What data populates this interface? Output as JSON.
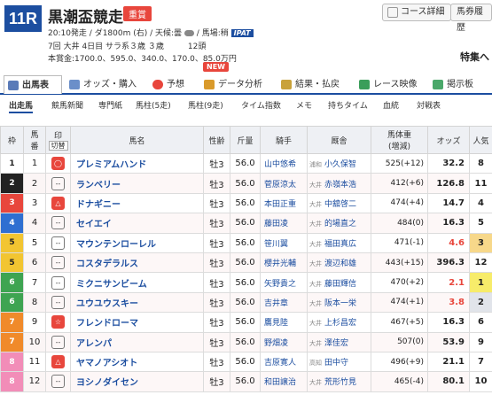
{
  "header": {
    "race_no": "11R",
    "race_name": "黒潮盃競走",
    "grade": "重賞",
    "course_btn": "コース詳細",
    "ticket_btn": "馬券履歴",
    "info1": "20:10発走 / ダ1800m (右) / 天候:曇",
    "info1b": "/ 馬場:稍",
    "ipat": "IPAT",
    "info2": "7回 大井 4日目 サラ系３歳 ３歳　　　12頭",
    "info3": "本賞金:1700.0、595.0、340.0、170.0、85.0万円",
    "tokushu": "特集へ",
    "new_badge": "NEW"
  },
  "tabs": [
    {
      "label": "出馬表",
      "icon": "horse-table-icon",
      "color": "#5a7bb8"
    },
    {
      "label": "オッズ・購入",
      "icon": "odds-chart-icon",
      "color": "#6b8fc9"
    },
    {
      "label": "予想",
      "icon": "target-icon",
      "color": "#e8463c"
    },
    {
      "label": "データ分析",
      "icon": "bar-chart-icon",
      "color": "#d99a2b"
    },
    {
      "label": "結果・払戻",
      "icon": "trophy-icon",
      "color": "#c9a23b"
    },
    {
      "label": "レース映像",
      "icon": "video-icon",
      "color": "#3b9e5a"
    },
    {
      "label": "掲示板",
      "icon": "chat-icon",
      "color": "#4aa86a"
    }
  ],
  "subtabs": [
    "出走馬",
    "競馬新聞",
    "専門紙",
    "馬柱(5走)",
    "馬柱(9走)",
    "タイム指数",
    "メモ",
    "持ちタイム",
    "血統",
    "対戦表"
  ],
  "table": {
    "headers": {
      "waku": "枠",
      "umaban1": "馬",
      "umaban2": "番",
      "mark1": "印",
      "mark2": "切替",
      "name": "馬名",
      "sex": "性齢",
      "kinryo": "斤量",
      "jockey": "騎手",
      "trainer": "厩舎",
      "weight1": "馬体重",
      "weight2": "(増減)",
      "odds": "オッズ",
      "pop": "人気"
    },
    "rows": [
      {
        "waku": "1",
        "waku_bg": "#ffffff",
        "waku_fg": "#222",
        "no": "1",
        "mark": "◯",
        "mark_type": "red",
        "name": "プレミアムハンド",
        "sex": "牡3",
        "kin": "56.0",
        "jockey": "山中悠希",
        "stable": "浦和",
        "trainer": "小久保智",
        "weight": "525(+12)",
        "odds": "32.2",
        "odds_color": "#222",
        "pop": "8",
        "pop_bg": "#ffffff"
      },
      {
        "waku": "2",
        "waku_bg": "#222222",
        "waku_fg": "#fff",
        "no": "2",
        "mark": "--",
        "mark_type": "gray",
        "name": "ランベリー",
        "sex": "牡3",
        "kin": "56.0",
        "jockey": "菅原涼太",
        "stable": "大井",
        "trainer": "赤嶺本浩",
        "weight": "412(+6)",
        "odds": "126.8",
        "odds_color": "#222",
        "pop": "11",
        "pop_bg": "#ffffff"
      },
      {
        "waku": "3",
        "waku_bg": "#e8463c",
        "waku_fg": "#fff",
        "no": "3",
        "mark": "△",
        "mark_type": "red",
        "name": "ドナギニー",
        "sex": "牡3",
        "kin": "56.0",
        "jockey": "本田正重",
        "stable": "大井",
        "trainer": "中舘啓二",
        "weight": "474(+4)",
        "odds": "14.7",
        "odds_color": "#222",
        "pop": "4",
        "pop_bg": "#ffffff"
      },
      {
        "waku": "4",
        "waku_bg": "#2f6fd1",
        "waku_fg": "#fff",
        "no": "4",
        "mark": "--",
        "mark_type": "gray",
        "name": "セイエイ",
        "sex": "牡3",
        "kin": "56.0",
        "jockey": "藤田凌",
        "stable": "大井",
        "trainer": "的場直之",
        "weight": "484(0)",
        "odds": "16.3",
        "odds_color": "#222",
        "pop": "5",
        "pop_bg": "#ffffff"
      },
      {
        "waku": "5",
        "waku_bg": "#f2c531",
        "waku_fg": "#222",
        "no": "5",
        "mark": "--",
        "mark_type": "gray",
        "name": "マウンテンローレル",
        "sex": "牡3",
        "kin": "56.0",
        "jockey": "笹川翼",
        "stable": "大井",
        "trainer": "福田真広",
        "weight": "471(-1)",
        "odds": "4.6",
        "odds_color": "#e8463c",
        "pop": "3",
        "pop_bg": "#f7d88a"
      },
      {
        "waku": "5",
        "waku_bg": "#f2c531",
        "waku_fg": "#222",
        "no": "6",
        "mark": "--",
        "mark_type": "gray",
        "name": "コスタデラルス",
        "sex": "牡3",
        "kin": "56.0",
        "jockey": "櫻井光輔",
        "stable": "大井",
        "trainer": "渡辺和雄",
        "weight": "443(+15)",
        "odds": "396.3",
        "odds_color": "#222",
        "pop": "12",
        "pop_bg": "#ffffff"
      },
      {
        "waku": "6",
        "waku_bg": "#3ea451",
        "waku_fg": "#fff",
        "no": "7",
        "mark": "--",
        "mark_type": "gray",
        "name": "ミクニサンビーム",
        "sex": "牡3",
        "kin": "56.0",
        "jockey": "矢野貴之",
        "stable": "大井",
        "trainer": "藤田輝信",
        "weight": "470(+2)",
        "odds": "2.1",
        "odds_color": "#e8463c",
        "pop": "1",
        "pop_bg": "#f7ec6a"
      },
      {
        "waku": "6",
        "waku_bg": "#3ea451",
        "waku_fg": "#fff",
        "no": "8",
        "mark": "--",
        "mark_type": "gray",
        "name": "ユウユウスキー",
        "sex": "牡3",
        "kin": "56.0",
        "jockey": "吉井章",
        "stable": "大井",
        "trainer": "阪本一栄",
        "weight": "474(+1)",
        "odds": "3.8",
        "odds_color": "#e8463c",
        "pop": "2",
        "pop_bg": "#e1e4ea"
      },
      {
        "waku": "7",
        "waku_bg": "#f08a2a",
        "waku_fg": "#fff",
        "no": "9",
        "mark": "☆",
        "mark_type": "red",
        "name": "フレンドローマ",
        "sex": "牡3",
        "kin": "56.0",
        "jockey": "鷹見陸",
        "stable": "大井",
        "trainer": "上杉昌宏",
        "weight": "467(+5)",
        "odds": "16.3",
        "odds_color": "#222",
        "pop": "6",
        "pop_bg": "#ffffff"
      },
      {
        "waku": "7",
        "waku_bg": "#f08a2a",
        "waku_fg": "#fff",
        "no": "10",
        "mark": "--",
        "mark_type": "gray",
        "name": "アレンパ",
        "sex": "牡3",
        "kin": "56.0",
        "jockey": "野畑凌",
        "stable": "大井",
        "trainer": "澤佳宏",
        "weight": "507(0)",
        "odds": "53.9",
        "odds_color": "#222",
        "pop": "9",
        "pop_bg": "#ffffff"
      },
      {
        "waku": "8",
        "waku_bg": "#f28db8",
        "waku_fg": "#fff",
        "no": "11",
        "mark": "△",
        "mark_type": "red",
        "name": "ヤマノアシオト",
        "sex": "牡3",
        "kin": "56.0",
        "jockey": "吉原寛人",
        "stable": "高知",
        "trainer": "田中守",
        "weight": "496(+9)",
        "odds": "21.1",
        "odds_color": "#222",
        "pop": "7",
        "pop_bg": "#ffffff"
      },
      {
        "waku": "8",
        "waku_bg": "#f28db8",
        "waku_fg": "#fff",
        "no": "12",
        "mark": "--",
        "mark_type": "gray",
        "name": "ヨシノダイセン",
        "sex": "牡3",
        "kin": "56.0",
        "jockey": "和田譲治",
        "stable": "大井",
        "trainer": "荒形竹見",
        "weight": "465(-4)",
        "odds": "80.1",
        "odds_color": "#222",
        "pop": "10",
        "pop_bg": "#ffffff"
      }
    ]
  }
}
